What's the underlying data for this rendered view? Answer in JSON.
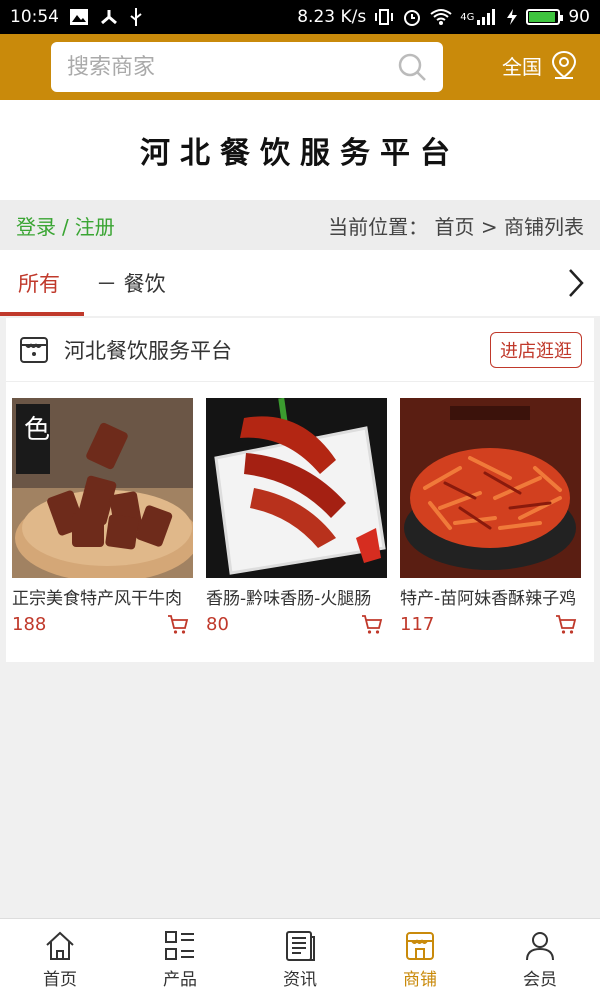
{
  "status_bar": {
    "time": "10:54",
    "speed": "8.23 K/s",
    "signal": "4G",
    "battery": "90"
  },
  "search": {
    "placeholder": "搜索商家",
    "region_label": "全国"
  },
  "banner": {
    "title": "河北餐饮服务平台"
  },
  "breadcrumb": {
    "login": "登录",
    "separator": "/",
    "register": "注册",
    "location_prefix": "当前位置：",
    "home": "首页",
    "arrow": ">",
    "current": "商铺列表"
  },
  "tabs": [
    {
      "label": "所有"
    },
    {
      "label": "－ 餐饮"
    }
  ],
  "shop": {
    "name": "河北餐饮服务平台",
    "visit_label": "进店逛逛",
    "products": [
      {
        "name": "正宗美食特产风干牛肉",
        "price": "188"
      },
      {
        "name": "香肠-黔味香肠-火腿肠",
        "price": "80"
      },
      {
        "name": "特产-苗阿妹香酥辣子鸡",
        "price": "117"
      }
    ]
  },
  "bottom_nav": [
    {
      "label": "首页",
      "icon": "home-icon"
    },
    {
      "label": "产品",
      "icon": "grid-list-icon"
    },
    {
      "label": "资讯",
      "icon": "news-icon"
    },
    {
      "label": "商铺",
      "icon": "store-icon",
      "active": true
    },
    {
      "label": "会员",
      "icon": "user-icon"
    }
  ],
  "colors": {
    "header": "#c98a0b",
    "accent_red": "#c0392b",
    "login_green": "#3aa533"
  }
}
